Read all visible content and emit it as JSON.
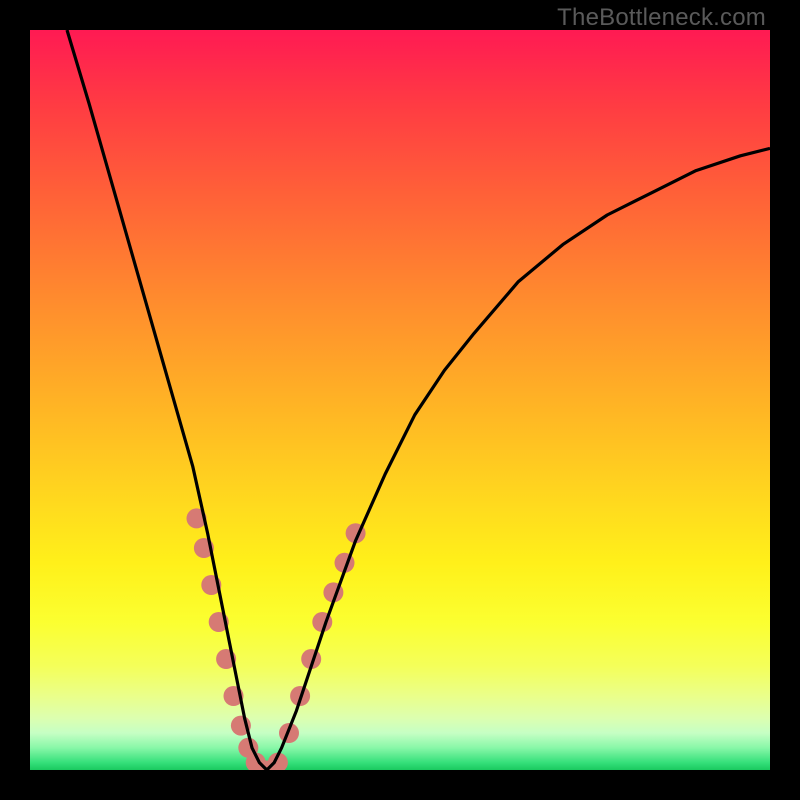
{
  "watermark": "TheBottleneck.com",
  "chart_data": {
    "type": "line",
    "title": "",
    "xlabel": "",
    "ylabel": "",
    "xlim": [
      0,
      100
    ],
    "ylim": [
      0,
      100
    ],
    "grid": false,
    "legend": false,
    "series": [
      {
        "name": "bottleneck-curve",
        "color": "#000000",
        "x": [
          5,
          8,
          10,
          12,
          14,
          16,
          18,
          20,
          22,
          24,
          25,
          26,
          27,
          28,
          29,
          30,
          31,
          32,
          33,
          34,
          36,
          38,
          40,
          44,
          48,
          52,
          56,
          60,
          66,
          72,
          78,
          84,
          90,
          96,
          100
        ],
        "y": [
          100,
          90,
          83,
          76,
          69,
          62,
          55,
          48,
          41,
          32,
          27,
          22,
          17,
          12,
          7,
          3,
          1,
          0,
          1,
          3,
          8,
          14,
          20,
          31,
          40,
          48,
          54,
          59,
          66,
          71,
          75,
          78,
          81,
          83,
          84
        ]
      }
    ],
    "markers": [
      {
        "name": "data-dots",
        "color": "#d67a74",
        "radius": 10,
        "points": [
          {
            "x": 22.5,
            "y": 34
          },
          {
            "x": 23.5,
            "y": 30
          },
          {
            "x": 24.5,
            "y": 25
          },
          {
            "x": 25.5,
            "y": 20
          },
          {
            "x": 26.5,
            "y": 15
          },
          {
            "x": 27.5,
            "y": 10
          },
          {
            "x": 28.5,
            "y": 6
          },
          {
            "x": 29.5,
            "y": 3
          },
          {
            "x": 30.5,
            "y": 1
          },
          {
            "x": 31.5,
            "y": 0
          },
          {
            "x": 32.5,
            "y": 0
          },
          {
            "x": 33.5,
            "y": 1
          },
          {
            "x": 35.0,
            "y": 5
          },
          {
            "x": 36.5,
            "y": 10
          },
          {
            "x": 38.0,
            "y": 15
          },
          {
            "x": 39.5,
            "y": 20
          },
          {
            "x": 41.0,
            "y": 24
          },
          {
            "x": 42.5,
            "y": 28
          },
          {
            "x": 44.0,
            "y": 32
          }
        ]
      }
    ]
  }
}
